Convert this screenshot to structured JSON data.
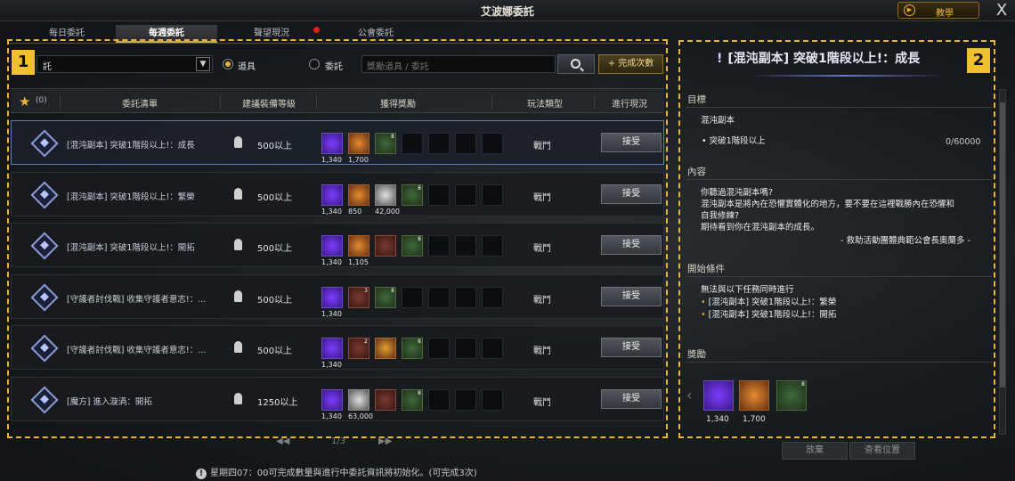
{
  "window": {
    "title": "艾波娜委託",
    "help_label": "教學",
    "close_label": "X"
  },
  "tabs": [
    "每日委託",
    "每週委託",
    "聲望現況",
    "公會委託"
  ],
  "filters": {
    "dropdown_value": "託",
    "radio_item": "道具",
    "radio_quest": "委託",
    "search_placeholder": "獎勵道具 / 委託",
    "complete_label": "+ 完成次數"
  },
  "annotations": {
    "left": "1",
    "right": "2"
  },
  "table": {
    "star_count": "(0)",
    "headers": [
      "委託清單",
      "建議裝備等級",
      "獲得獎勵",
      "玩法類型",
      "進行現況"
    ],
    "accept_label": "接受",
    "rows": [
      {
        "name": "[混沌副本] 突破1階段以上!：成長",
        "level": "500以上",
        "type": "戰鬥",
        "rewards": [
          {
            "c": "purple",
            "q": "1,340"
          },
          {
            "c": "orange",
            "q": "1,700"
          },
          {
            "c": "green",
            "q": "",
            "s": "8"
          }
        ]
      },
      {
        "name": "[混沌副本] 突破1階段以上!：繁榮",
        "level": "500以上",
        "type": "戰鬥",
        "rewards": [
          {
            "c": "purple",
            "q": "1,340"
          },
          {
            "c": "orange",
            "q": "850"
          },
          {
            "c": "silver",
            "q": "42,000"
          },
          {
            "c": "green",
            "q": "",
            "s": "8"
          }
        ]
      },
      {
        "name": "[混沌副本] 突破1階段以上!：開拓",
        "level": "500以上",
        "type": "戰鬥",
        "rewards": [
          {
            "c": "purple",
            "q": "1,340"
          },
          {
            "c": "orange",
            "q": "1,105"
          },
          {
            "c": "red",
            "q": ""
          },
          {
            "c": "green",
            "q": "",
            "s": "8"
          }
        ]
      },
      {
        "name": "[守護者討伐戰] 收集守護者意志!：...",
        "level": "500以上",
        "type": "戰鬥",
        "rewards": [
          {
            "c": "purple",
            "q": "1,340"
          },
          {
            "c": "red",
            "q": "",
            "s": "3"
          },
          {
            "c": "green",
            "q": "",
            "s": "8"
          }
        ]
      },
      {
        "name": "[守護者討伐戰] 收集守護者意志!：...",
        "level": "500以上",
        "type": "戰鬥",
        "rewards": [
          {
            "c": "purple",
            "q": "1,340"
          },
          {
            "c": "red",
            "q": "",
            "s": "2"
          },
          {
            "c": "gold",
            "q": ""
          },
          {
            "c": "green",
            "q": "",
            "s": "8"
          }
        ]
      },
      {
        "name": "[魔方] 進入漩渦：開拓",
        "level": "1250以上",
        "type": "戰鬥",
        "rewards": [
          {
            "c": "purple",
            "q": "1,340"
          },
          {
            "c": "silver",
            "q": "63,000"
          },
          {
            "c": "red",
            "q": ""
          },
          {
            "c": "green",
            "q": "",
            "s": "8"
          }
        ]
      }
    ]
  },
  "pager": {
    "text": "1/3"
  },
  "footer": "星期四07：00可完成數量與進行中委託資訊將初始化。(可完成3次)",
  "detail": {
    "title": "[混沌副本] 突破1階段以上!：成長",
    "goal_header": "目標",
    "goal_name": "混沌副本",
    "goal_item": "• 突破1階段以上",
    "goal_progress": "0/60000",
    "content_header": "內容",
    "content_lines": [
      "你聽過混沌副本嗎?",
      "混沌副本是將內在恐懼實體化的地方，要不要在這裡戰勝內在恐懼和",
      "自我修練?",
      "期待看到你在混沌副本的成長。"
    ],
    "signature": "- 救助活動團體典範公會長奧蘭多 -",
    "start_header": "開始條件",
    "start_line": "無法與以下任務同時進行",
    "start_items": [
      "[混沌副本] 突破1階段以上!：繁榮",
      "[混沌副本] 突破1階段以上!：開拓"
    ],
    "reward_header": "獎勵",
    "reward_qty": [
      "1,340",
      "1,700"
    ],
    "reward_sub": "8",
    "abandon_label": "放棄",
    "location_label": "查看位置"
  }
}
